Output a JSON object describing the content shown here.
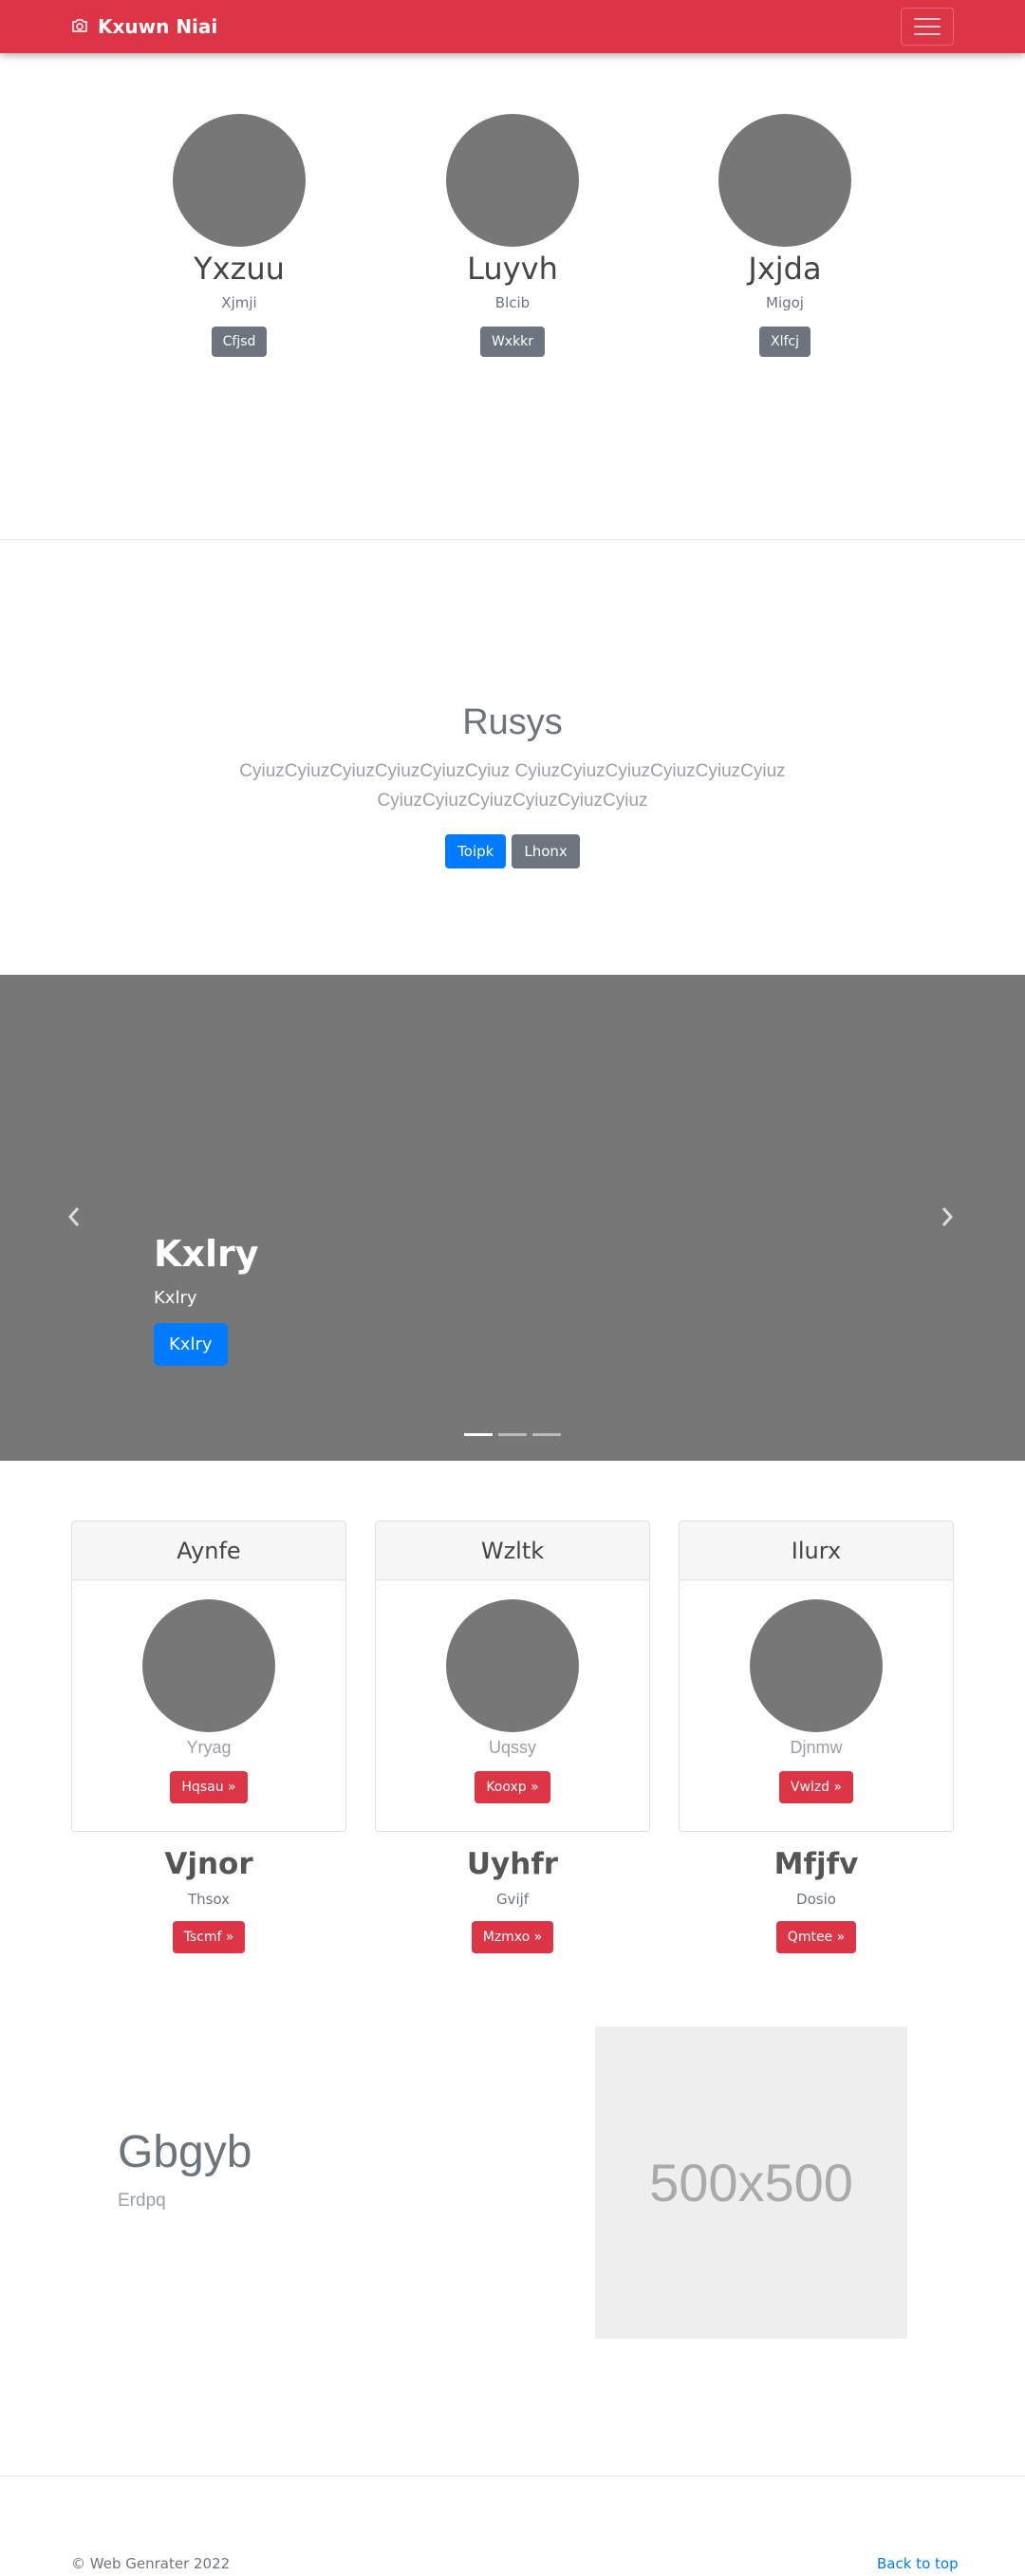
{
  "nav": {
    "brand": "Kxuwn Niai",
    "brand_icon": "camera-icon",
    "toggle_icon": "hamburger-icon"
  },
  "team": [
    {
      "name": "Yxzuu",
      "sub": "Xjmji",
      "button": "Cfjsd"
    },
    {
      "name": "Luyvh",
      "sub": "Blcib",
      "button": "Wxkkr"
    },
    {
      "name": "Jxjda",
      "sub": "Migoj",
      "button": "Xlfcj"
    }
  ],
  "hero": {
    "title": "Rusys",
    "lead": "CyiuzCyiuzCyiuzCyiuzCyiuzCyiuz CyiuzCyiuzCyiuzCyiuzCyiuzCyiuz CyiuzCyiuzCyiuzCyiuzCyiuzCyiuz",
    "primary_button": "Toipk",
    "secondary_button": "Lhonx"
  },
  "carousel": {
    "title": "Kxlry",
    "text": "Kxlry",
    "button": "Kxlry",
    "prev_icon": "chevron-left-icon",
    "next_icon": "chevron-right-icon",
    "indicator_count": 3,
    "active_index": 0
  },
  "cards": [
    {
      "header": "Aynfe",
      "text": "Yryag",
      "button": "Hqsau »"
    },
    {
      "header": "Wzltk",
      "text": "Uqssy",
      "button": "Kooxp »"
    },
    {
      "header": "Ilurx",
      "text": "Djnmw",
      "button": "Vwlzd »"
    }
  ],
  "features": [
    {
      "title": "Vjnor",
      "sub": "Thsox",
      "button": "Tscmf »"
    },
    {
      "title": "Uyhfr",
      "sub": "Gvijf",
      "button": "Mzmxo »"
    },
    {
      "title": "Mfjfv",
      "sub": "Dosio",
      "button": "Qmtee »"
    }
  ],
  "split": {
    "title": "Gbgyb",
    "sub": "Erdpq",
    "placeholder": "500x500"
  },
  "footer": {
    "copyright": "© Web Genrater 2022",
    "back_to_top": "Back to top"
  },
  "colors": {
    "brand_red": "#dc3545",
    "primary_blue": "#007bff",
    "secondary_gray": "#6c757d",
    "placeholder_gray": "#777777"
  }
}
